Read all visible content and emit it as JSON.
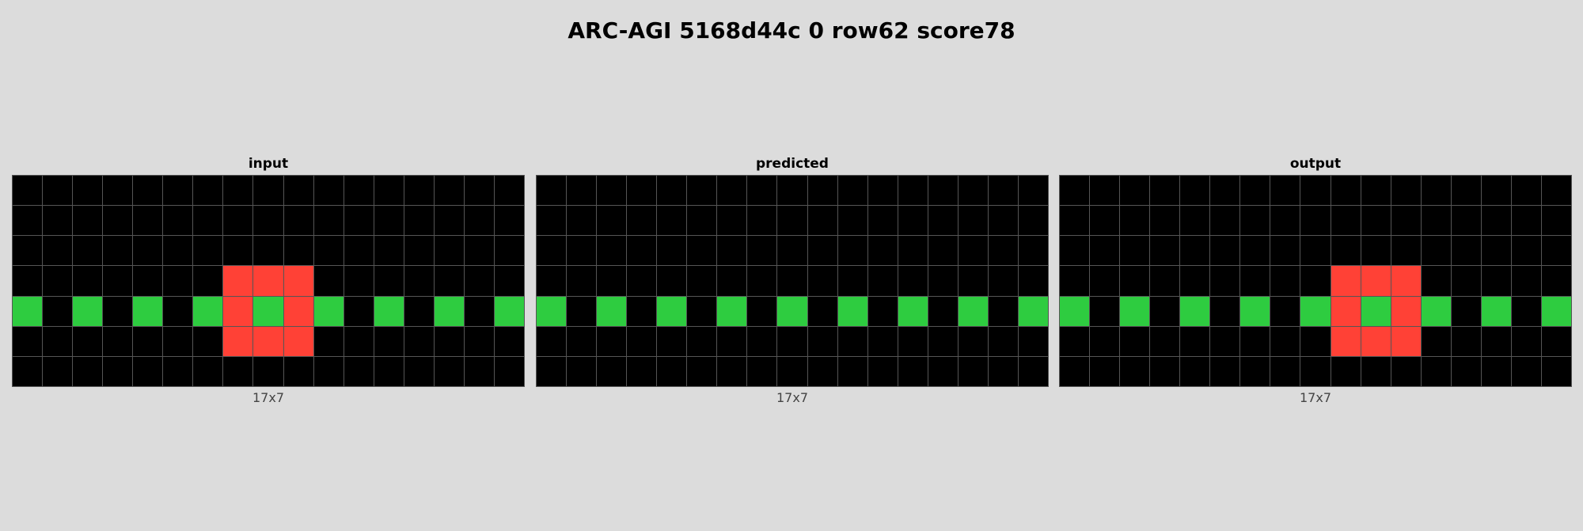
{
  "title": "ARC-AGI 5168d44c 0 row62 score78",
  "palette": {
    "0": "#000000",
    "2": "#ff4136",
    "3": "#2ecc40"
  },
  "panels": [
    {
      "label": "input",
      "dims": "17x7",
      "grid": [
        [
          0,
          0,
          0,
          0,
          0,
          0,
          0,
          0,
          0,
          0,
          0,
          0,
          0,
          0,
          0,
          0,
          0
        ],
        [
          0,
          0,
          0,
          0,
          0,
          0,
          0,
          0,
          0,
          0,
          0,
          0,
          0,
          0,
          0,
          0,
          0
        ],
        [
          0,
          0,
          0,
          0,
          0,
          0,
          0,
          0,
          0,
          0,
          0,
          0,
          0,
          0,
          0,
          0,
          0
        ],
        [
          0,
          0,
          0,
          0,
          0,
          0,
          0,
          2,
          2,
          2,
          0,
          0,
          0,
          0,
          0,
          0,
          0
        ],
        [
          3,
          0,
          3,
          0,
          3,
          0,
          3,
          2,
          3,
          2,
          3,
          0,
          3,
          0,
          3,
          0,
          3
        ],
        [
          0,
          0,
          0,
          0,
          0,
          0,
          0,
          2,
          2,
          2,
          0,
          0,
          0,
          0,
          0,
          0,
          0
        ],
        [
          0,
          0,
          0,
          0,
          0,
          0,
          0,
          0,
          0,
          0,
          0,
          0,
          0,
          0,
          0,
          0,
          0
        ]
      ]
    },
    {
      "label": "predicted",
      "dims": "17x7",
      "grid": [
        [
          0,
          0,
          0,
          0,
          0,
          0,
          0,
          0,
          0,
          0,
          0,
          0,
          0,
          0,
          0,
          0,
          0
        ],
        [
          0,
          0,
          0,
          0,
          0,
          0,
          0,
          0,
          0,
          0,
          0,
          0,
          0,
          0,
          0,
          0,
          0
        ],
        [
          0,
          0,
          0,
          0,
          0,
          0,
          0,
          0,
          0,
          0,
          0,
          0,
          0,
          0,
          0,
          0,
          0
        ],
        [
          0,
          0,
          0,
          0,
          0,
          0,
          0,
          0,
          0,
          0,
          0,
          0,
          0,
          0,
          0,
          0,
          0
        ],
        [
          3,
          0,
          3,
          0,
          3,
          0,
          3,
          0,
          3,
          0,
          3,
          0,
          3,
          0,
          3,
          0,
          3
        ],
        [
          0,
          0,
          0,
          0,
          0,
          0,
          0,
          0,
          0,
          0,
          0,
          0,
          0,
          0,
          0,
          0,
          0
        ],
        [
          0,
          0,
          0,
          0,
          0,
          0,
          0,
          0,
          0,
          0,
          0,
          0,
          0,
          0,
          0,
          0,
          0
        ]
      ]
    },
    {
      "label": "output",
      "dims": "17x7",
      "grid": [
        [
          0,
          0,
          0,
          0,
          0,
          0,
          0,
          0,
          0,
          0,
          0,
          0,
          0,
          0,
          0,
          0,
          0
        ],
        [
          0,
          0,
          0,
          0,
          0,
          0,
          0,
          0,
          0,
          0,
          0,
          0,
          0,
          0,
          0,
          0,
          0
        ],
        [
          0,
          0,
          0,
          0,
          0,
          0,
          0,
          0,
          0,
          0,
          0,
          0,
          0,
          0,
          0,
          0,
          0
        ],
        [
          0,
          0,
          0,
          0,
          0,
          0,
          0,
          0,
          0,
          2,
          2,
          2,
          0,
          0,
          0,
          0,
          0
        ],
        [
          3,
          0,
          3,
          0,
          3,
          0,
          3,
          0,
          3,
          2,
          3,
          2,
          3,
          0,
          3,
          0,
          3
        ],
        [
          0,
          0,
          0,
          0,
          0,
          0,
          0,
          0,
          0,
          2,
          2,
          2,
          0,
          0,
          0,
          0,
          0
        ],
        [
          0,
          0,
          0,
          0,
          0,
          0,
          0,
          0,
          0,
          0,
          0,
          0,
          0,
          0,
          0,
          0,
          0
        ]
      ]
    }
  ]
}
